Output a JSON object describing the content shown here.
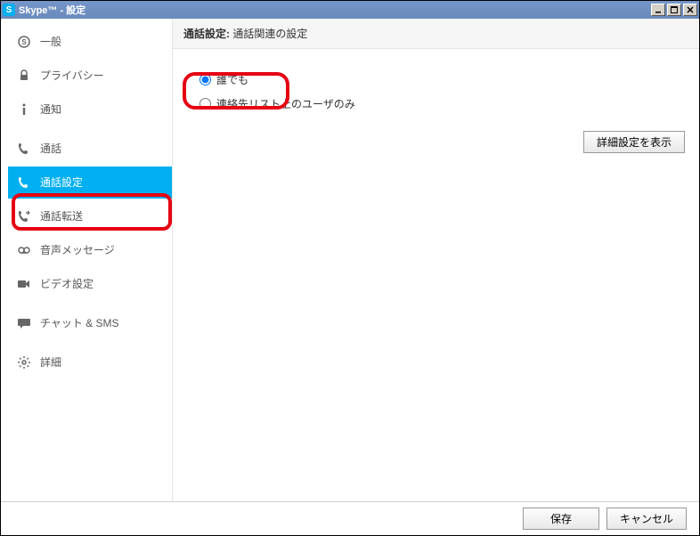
{
  "titlebar": {
    "logo_letter": "S",
    "title": "Skype™ - 設定"
  },
  "sidebar": {
    "items": [
      {
        "label": "一般"
      },
      {
        "label": "プライバシー"
      },
      {
        "label": "通知"
      },
      {
        "label": "通話"
      },
      {
        "label": "通話設定"
      },
      {
        "label": "通話転送"
      },
      {
        "label": "音声メッセージ"
      },
      {
        "label": "ビデオ設定"
      },
      {
        "label": "チャット & SMS"
      },
      {
        "label": "詳細"
      }
    ]
  },
  "content": {
    "header_bold": "通話設定:",
    "header_rest": " 通話関連の設定",
    "radio_everyone": "誰でも",
    "radio_contacts_only": "連絡先リスト上のユーザのみ",
    "detail_btn": "詳細設定を表示"
  },
  "footer": {
    "save": "保存",
    "cancel": "キャンセル"
  }
}
